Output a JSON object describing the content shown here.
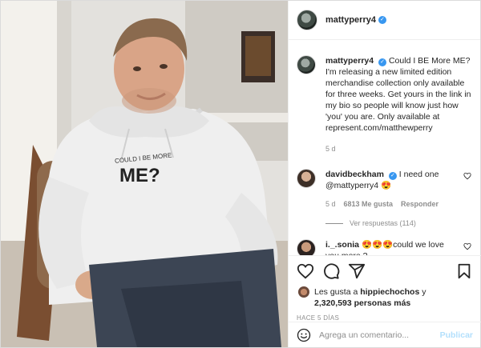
{
  "post": {
    "username": "mattyperry4",
    "verified": true,
    "caption": {
      "username": "mattyperry4",
      "text": "Could I BE More ME? I'm releasing a new limited edition merchandise collection only available for three weeks. Get yours in the link in my bio so people will know just how 'you' you are. Only available at represent.com/matthewperry",
      "time": "5 d"
    },
    "photo": {
      "shirt_print_small": "COULD I BE MORE",
      "shirt_print_large": "ME?"
    }
  },
  "comments": [
    {
      "username": "davidbeckham",
      "verified": true,
      "text": "I need one @mattyperry4 😍",
      "time": "5 d",
      "likes": "6813 Me gusta",
      "reply_label": "Responder",
      "view_replies": "Ver respuestas (114)"
    },
    {
      "username": "i._.sonia",
      "verified": false,
      "text": "😍😍😍could we love you more ?"
    }
  ],
  "likes": {
    "prefix": "Les gusta a",
    "user": "hippiechochos",
    "connector": "y",
    "count": "2,320,593 personas más"
  },
  "time_ago": "HACE 5 DÍAS",
  "add_comment": {
    "placeholder": "Agrega un comentario...",
    "publish_label": "Publicar"
  },
  "colors": {
    "verified": "#3897f0",
    "publish_disabled": "#b2dffc",
    "secondary_text": "#8e8e8e"
  },
  "icons": [
    "heart-icon",
    "comment-icon",
    "share-icon",
    "bookmark-icon",
    "emoji-icon",
    "verified-icon"
  ]
}
